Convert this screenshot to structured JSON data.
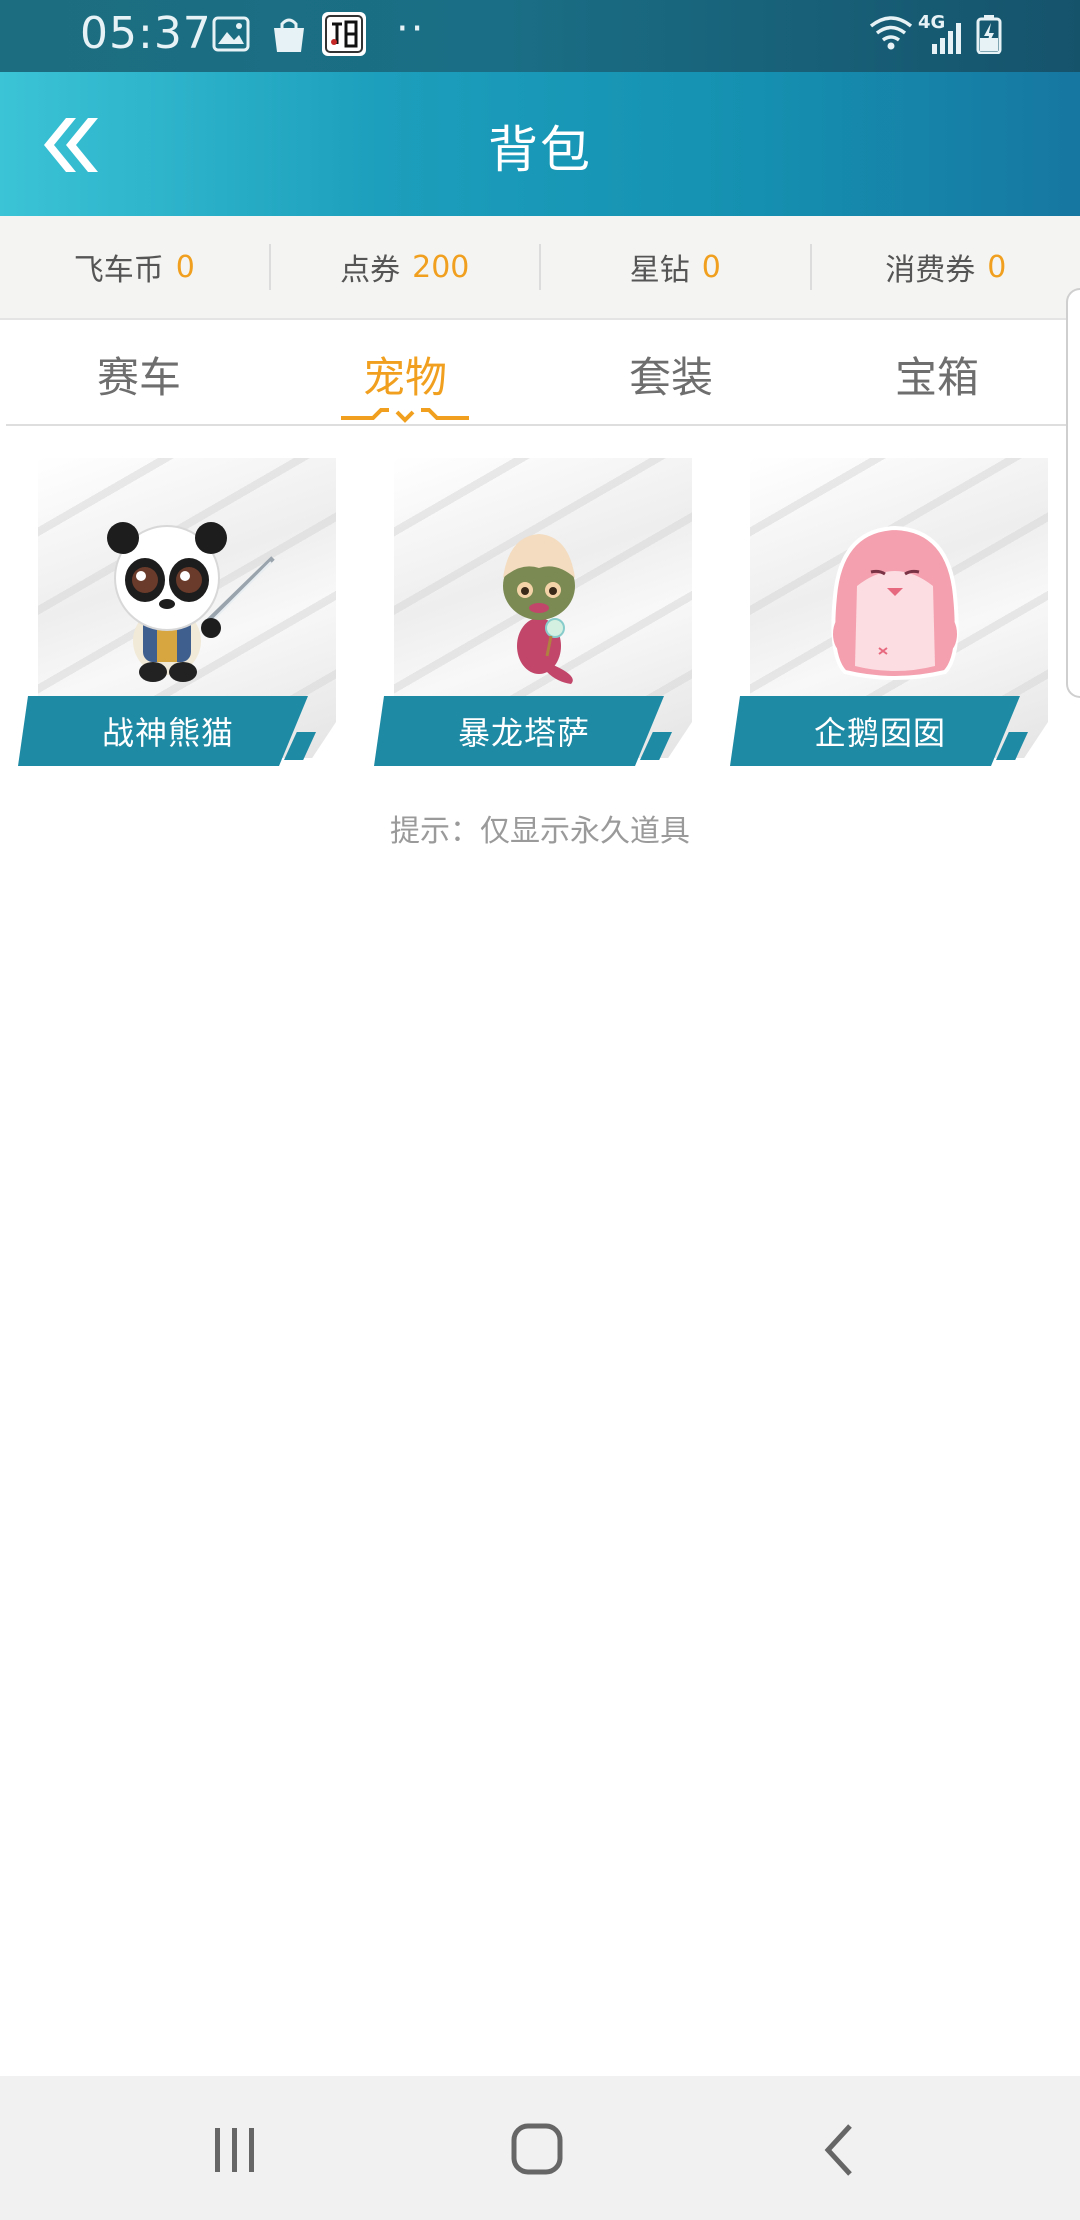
{
  "status_bar": {
    "time": "05:37",
    "network": "4G",
    "dots": "··",
    "icons": [
      "gallery-icon",
      "shopping-bag-icon",
      "app-notification-icon",
      "wifi-icon",
      "signal-icon",
      "battery-charging-icon"
    ]
  },
  "header": {
    "title": "背包",
    "back_icon": "double-chevron-left-icon"
  },
  "currencies": [
    {
      "label": "飞车币",
      "value": "0"
    },
    {
      "label": "点券",
      "value": "200"
    },
    {
      "label": "星钻",
      "value": "0"
    },
    {
      "label": "消费券",
      "value": "0"
    }
  ],
  "tabs": [
    {
      "label": "赛车",
      "active": false
    },
    {
      "label": "宠物",
      "active": true
    },
    {
      "label": "套装",
      "active": false
    },
    {
      "label": "宝箱",
      "active": false
    }
  ],
  "items": [
    {
      "name": "战神熊猫",
      "image": "panda-warrior-pet"
    },
    {
      "name": "暴龙塔萨",
      "image": "baby-dinosaur-pet"
    },
    {
      "name": "企鹅囡囡",
      "image": "pink-penguin-pet"
    }
  ],
  "hint": "提示：仅显示永久道具",
  "colors": {
    "accent": "#f0a01e",
    "header": "#1c9fbc",
    "ribbon": "#1f8aa4"
  },
  "nav_bar": {
    "buttons": [
      "recent-apps-icon",
      "home-icon",
      "back-icon"
    ]
  }
}
